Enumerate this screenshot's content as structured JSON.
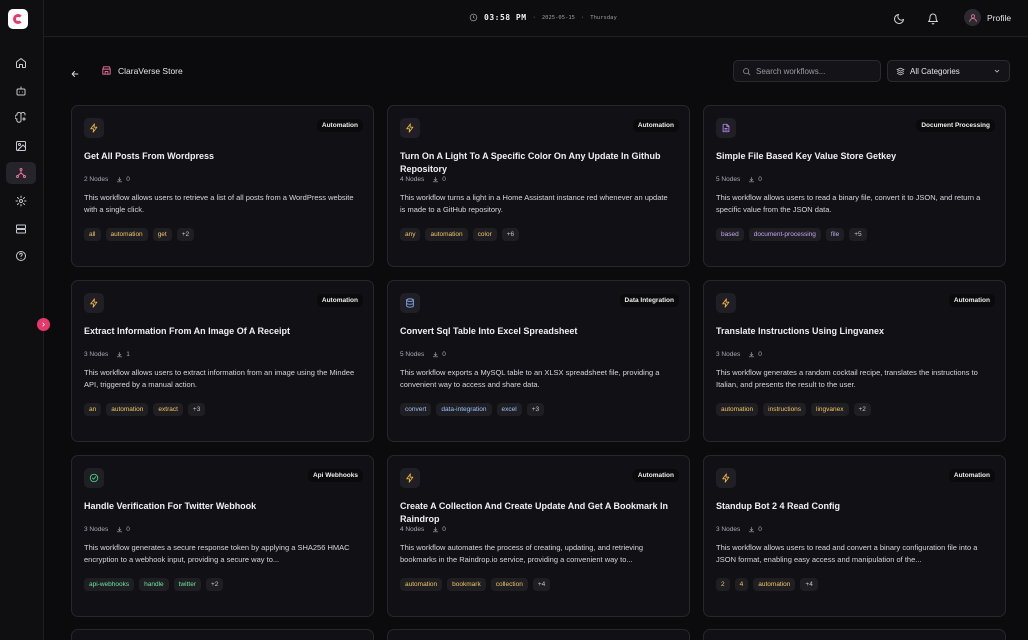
{
  "topbar": {
    "time": "03:58 PM",
    "date": "2025-05-15",
    "day": "Thursday",
    "profile_label": "Profile"
  },
  "header": {
    "store_title": "ClaraVerse Store",
    "search_placeholder": "Search workflows...",
    "category_selected": "All Categories"
  },
  "sidebar": {
    "items": [
      "home-icon",
      "bot-icon",
      "brain-icon",
      "image-icon",
      "network-icon",
      "settings-icon",
      "server-icon",
      "help-icon"
    ],
    "active": "network-icon"
  },
  "colors": {
    "accent": "#e8386b",
    "automation_icon": "#f5b942",
    "document_icon": "#b98cf5",
    "data_icon": "#8ab4f8",
    "webhook_icon": "#4ade80"
  },
  "cards": [
    {
      "icon": "bolt-icon",
      "category": "Automation",
      "title": "Get All Posts From Wordpress",
      "nodes": "2 Nodes",
      "downloads": "0",
      "description": "This workflow allows users to retrieve a list of all posts from a WordPress website with a single click.",
      "tags": [
        "all",
        "automation",
        "get"
      ],
      "more": "+2"
    },
    {
      "icon": "bolt-icon",
      "category": "Automation",
      "title": "Turn On A Light To A Specific Color On Any Update In Github Repository",
      "nodes": "4 Nodes",
      "downloads": "0",
      "description": "This workflow turns a light in a Home Assistant instance red whenever an update is made to a GitHub repository.",
      "tags": [
        "any",
        "automation",
        "color"
      ],
      "more": "+6"
    },
    {
      "icon": "document-icon",
      "category": "Document Processing",
      "title": "Simple File Based Key Value Store Getkey",
      "nodes": "5 Nodes",
      "downloads": "0",
      "description": "This workflow allows users to read a binary file, convert it to JSON, and return a specific value from the JSON data.",
      "tags": [
        "based",
        "document-processing",
        "file"
      ],
      "more": "+5"
    },
    {
      "icon": "bolt-icon",
      "category": "Automation",
      "title": "Extract Information From An Image Of A Receipt",
      "nodes": "3 Nodes",
      "downloads": "1",
      "description": "This workflow allows users to extract information from an image using the Mindee API, triggered by a manual action.",
      "tags": [
        "an",
        "automation",
        "extract"
      ],
      "more": "+3"
    },
    {
      "icon": "database-icon",
      "category": "Data Integration",
      "title": "Convert Sql Table Into Excel Spreadsheet",
      "nodes": "5 Nodes",
      "downloads": "0",
      "description": "This workflow exports a MySQL table to an XLSX spreadsheet file, providing a convenient way to access and share data.",
      "tags": [
        "convert",
        "data-integration",
        "excel"
      ],
      "more": "+3"
    },
    {
      "icon": "bolt-icon",
      "category": "Automation",
      "title": "Translate Instructions Using Lingvanex",
      "nodes": "3 Nodes",
      "downloads": "0",
      "description": "This workflow generates a random cocktail recipe, translates the instructions to Italian, and presents the result to the user.",
      "tags": [
        "automation",
        "instructions",
        "lingvanex"
      ],
      "more": "+2"
    },
    {
      "icon": "webhook-icon",
      "category": "Api Webhooks",
      "title": "Handle Verification For Twitter Webhook",
      "nodes": "3 Nodes",
      "downloads": "0",
      "description": "This workflow generates a secure response token by applying a SHA256 HMAC encryption to a webhook input, providing a secure way to...",
      "tags": [
        "api-webhooks",
        "handle",
        "twitter"
      ],
      "more": "+2"
    },
    {
      "icon": "bolt-icon",
      "category": "Automation",
      "title": "Create A Collection And Create Update And Get A Bookmark In Raindrop",
      "nodes": "4 Nodes",
      "downloads": "0",
      "description": "This workflow automates the process of creating, updating, and retrieving bookmarks in the Raindrop.io service, providing a convenient way to...",
      "tags": [
        "automation",
        "bookmark",
        "collection"
      ],
      "more": "+4"
    },
    {
      "icon": "bolt-icon",
      "category": "Automation",
      "title": "Standup Bot 2 4 Read Config",
      "nodes": "3 Nodes",
      "downloads": "0",
      "description": "This workflow allows users to read and convert a binary configuration file into a JSON format, enabling easy access and manipulation of the...",
      "tags": [
        "2",
        "4",
        "automation"
      ],
      "more": "+4"
    }
  ]
}
